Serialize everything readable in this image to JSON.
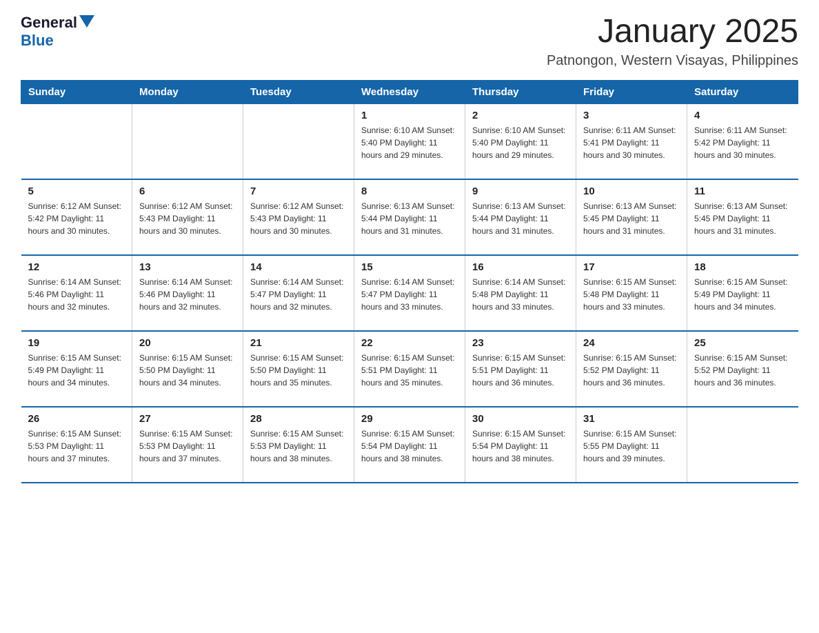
{
  "header": {
    "logo": {
      "general": "General",
      "blue": "Blue"
    },
    "title": "January 2025",
    "location": "Patnongon, Western Visayas, Philippines"
  },
  "weekdays": [
    "Sunday",
    "Monday",
    "Tuesday",
    "Wednesday",
    "Thursday",
    "Friday",
    "Saturday"
  ],
  "weeks": [
    [
      {
        "day": "",
        "info": ""
      },
      {
        "day": "",
        "info": ""
      },
      {
        "day": "",
        "info": ""
      },
      {
        "day": "1",
        "info": "Sunrise: 6:10 AM\nSunset: 5:40 PM\nDaylight: 11 hours\nand 29 minutes."
      },
      {
        "day": "2",
        "info": "Sunrise: 6:10 AM\nSunset: 5:40 PM\nDaylight: 11 hours\nand 29 minutes."
      },
      {
        "day": "3",
        "info": "Sunrise: 6:11 AM\nSunset: 5:41 PM\nDaylight: 11 hours\nand 30 minutes."
      },
      {
        "day": "4",
        "info": "Sunrise: 6:11 AM\nSunset: 5:42 PM\nDaylight: 11 hours\nand 30 minutes."
      }
    ],
    [
      {
        "day": "5",
        "info": "Sunrise: 6:12 AM\nSunset: 5:42 PM\nDaylight: 11 hours\nand 30 minutes."
      },
      {
        "day": "6",
        "info": "Sunrise: 6:12 AM\nSunset: 5:43 PM\nDaylight: 11 hours\nand 30 minutes."
      },
      {
        "day": "7",
        "info": "Sunrise: 6:12 AM\nSunset: 5:43 PM\nDaylight: 11 hours\nand 30 minutes."
      },
      {
        "day": "8",
        "info": "Sunrise: 6:13 AM\nSunset: 5:44 PM\nDaylight: 11 hours\nand 31 minutes."
      },
      {
        "day": "9",
        "info": "Sunrise: 6:13 AM\nSunset: 5:44 PM\nDaylight: 11 hours\nand 31 minutes."
      },
      {
        "day": "10",
        "info": "Sunrise: 6:13 AM\nSunset: 5:45 PM\nDaylight: 11 hours\nand 31 minutes."
      },
      {
        "day": "11",
        "info": "Sunrise: 6:13 AM\nSunset: 5:45 PM\nDaylight: 11 hours\nand 31 minutes."
      }
    ],
    [
      {
        "day": "12",
        "info": "Sunrise: 6:14 AM\nSunset: 5:46 PM\nDaylight: 11 hours\nand 32 minutes."
      },
      {
        "day": "13",
        "info": "Sunrise: 6:14 AM\nSunset: 5:46 PM\nDaylight: 11 hours\nand 32 minutes."
      },
      {
        "day": "14",
        "info": "Sunrise: 6:14 AM\nSunset: 5:47 PM\nDaylight: 11 hours\nand 32 minutes."
      },
      {
        "day": "15",
        "info": "Sunrise: 6:14 AM\nSunset: 5:47 PM\nDaylight: 11 hours\nand 33 minutes."
      },
      {
        "day": "16",
        "info": "Sunrise: 6:14 AM\nSunset: 5:48 PM\nDaylight: 11 hours\nand 33 minutes."
      },
      {
        "day": "17",
        "info": "Sunrise: 6:15 AM\nSunset: 5:48 PM\nDaylight: 11 hours\nand 33 minutes."
      },
      {
        "day": "18",
        "info": "Sunrise: 6:15 AM\nSunset: 5:49 PM\nDaylight: 11 hours\nand 34 minutes."
      }
    ],
    [
      {
        "day": "19",
        "info": "Sunrise: 6:15 AM\nSunset: 5:49 PM\nDaylight: 11 hours\nand 34 minutes."
      },
      {
        "day": "20",
        "info": "Sunrise: 6:15 AM\nSunset: 5:50 PM\nDaylight: 11 hours\nand 34 minutes."
      },
      {
        "day": "21",
        "info": "Sunrise: 6:15 AM\nSunset: 5:50 PM\nDaylight: 11 hours\nand 35 minutes."
      },
      {
        "day": "22",
        "info": "Sunrise: 6:15 AM\nSunset: 5:51 PM\nDaylight: 11 hours\nand 35 minutes."
      },
      {
        "day": "23",
        "info": "Sunrise: 6:15 AM\nSunset: 5:51 PM\nDaylight: 11 hours\nand 36 minutes."
      },
      {
        "day": "24",
        "info": "Sunrise: 6:15 AM\nSunset: 5:52 PM\nDaylight: 11 hours\nand 36 minutes."
      },
      {
        "day": "25",
        "info": "Sunrise: 6:15 AM\nSunset: 5:52 PM\nDaylight: 11 hours\nand 36 minutes."
      }
    ],
    [
      {
        "day": "26",
        "info": "Sunrise: 6:15 AM\nSunset: 5:53 PM\nDaylight: 11 hours\nand 37 minutes."
      },
      {
        "day": "27",
        "info": "Sunrise: 6:15 AM\nSunset: 5:53 PM\nDaylight: 11 hours\nand 37 minutes."
      },
      {
        "day": "28",
        "info": "Sunrise: 6:15 AM\nSunset: 5:53 PM\nDaylight: 11 hours\nand 38 minutes."
      },
      {
        "day": "29",
        "info": "Sunrise: 6:15 AM\nSunset: 5:54 PM\nDaylight: 11 hours\nand 38 minutes."
      },
      {
        "day": "30",
        "info": "Sunrise: 6:15 AM\nSunset: 5:54 PM\nDaylight: 11 hours\nand 38 minutes."
      },
      {
        "day": "31",
        "info": "Sunrise: 6:15 AM\nSunset: 5:55 PM\nDaylight: 11 hours\nand 39 minutes."
      },
      {
        "day": "",
        "info": ""
      }
    ]
  ]
}
